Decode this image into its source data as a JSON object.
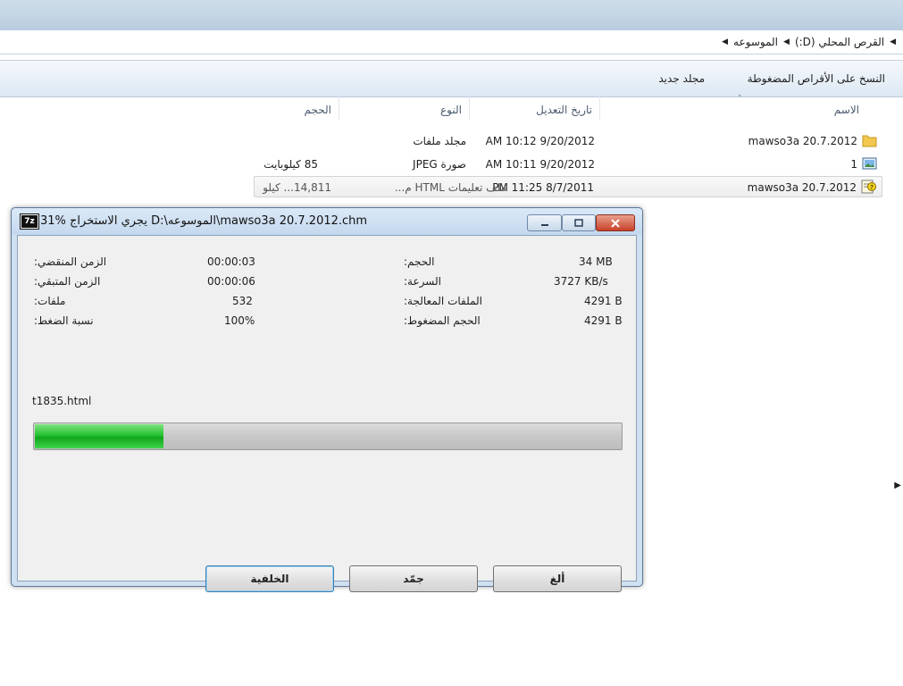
{
  "explorer": {
    "breadcrumb": [
      "القرص المحلي (D:)",
      "الموسوعه"
    ],
    "toolbar": {
      "burn_label": "النسخ على الأقراص المضغوطة",
      "new_folder_label": "مجلد جديد"
    },
    "columns": {
      "name": "الاسم",
      "date": "تاريخ التعديل",
      "type": "النوع",
      "size": "الحجم"
    },
    "files": [
      {
        "name": "mawso3a 20.7.2012",
        "date": "9/20/2012 10:12 AM",
        "type": "مجلد ملفات",
        "size": "",
        "icon": "folder-icon"
      },
      {
        "name": "1",
        "date": "9/20/2012 10:11 AM",
        "type": "صورة JPEG",
        "size": "85 كيلوبايت",
        "icon": "image-file-icon"
      },
      {
        "name": "mawso3a 20.7.2012",
        "date": "8/7/2011 11:25 PM",
        "type": "ملف تعليمات HTML م...",
        "size": "14,811... كيلو",
        "icon": "help-file-icon"
      }
    ]
  },
  "dialog": {
    "title": "31% يجري الاستخراج D:\\الموسوعه\\mawso3a 20.7.2012.chm",
    "app_icon_text": "7z",
    "stats": {
      "elapsed_label": "الزمن المنقضي:",
      "elapsed_value": "00:00:03",
      "remaining_label": "الزمن المتبقي:",
      "remaining_value": "00:00:06",
      "files_label": "ملفات:",
      "files_value": "532",
      "ratio_label": "نسبة الضغط:",
      "ratio_value": "100%",
      "size_label": "الحجم:",
      "size_value": "34 MB",
      "speed_label": "السرعة:",
      "speed_value": "3727 KB/s",
      "processed_label": "الملفات المعالجة:",
      "processed_value": "4291 B",
      "compressed_label": "الحجم المضغوط:",
      "compressed_value": "4291 B"
    },
    "current_file": "t1835.html",
    "progress_percent": 22,
    "buttons": {
      "background": "الخلفية",
      "pause": "جمّد",
      "cancel": "ألغ"
    }
  },
  "colors": {
    "progress_green": "#1fb52b",
    "dialog_frame": "#cfe0f1",
    "close_red": "#c8412a"
  }
}
